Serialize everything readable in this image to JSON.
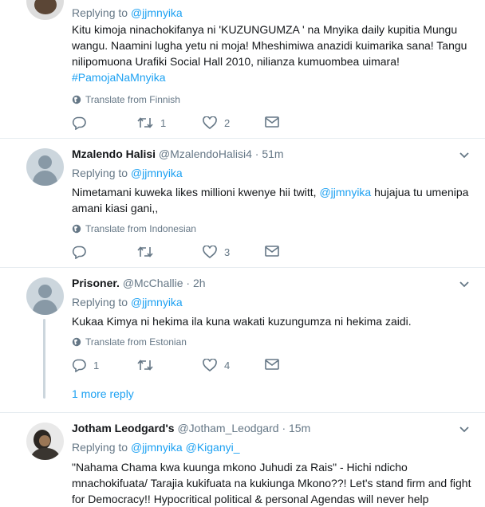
{
  "tweets": [
    {
      "replying_prefix": "Replying to",
      "replying_to": "@jjmnyika",
      "text": "Kitu kimoja ninachokifanya ni 'KUZUNGUMZA ' na Mnyika daily kupitia Mungu wangu. Naamini lugha yetu ni moja! Mheshimiwa anazidi kuimarika sana! Tangu nilipomuona Urafiki Social Hall 2010, nilianza kumuombea uimara!",
      "hashtag": "#PamojaNaMnyika",
      "translate": "Translate from Finnish",
      "reply_count": "",
      "retweet_count": "1",
      "like_count": "2"
    },
    {
      "name": "Mzalendo Halisi",
      "handle": "@MzalendoHalisi4",
      "dot": "·",
      "time": "51m",
      "replying_prefix": "Replying to",
      "replying_to": "@jjmnyika",
      "text_before": "Nimetamani kuweka likes millioni kwenye hii twitt, ",
      "mention": "@jjmnyika",
      "text_after": " hujajua tu umenipa amani kiasi gani,,",
      "translate": "Translate from Indonesian",
      "reply_count": "",
      "retweet_count": "",
      "like_count": "3"
    },
    {
      "name": "Prisoner.",
      "handle": "@McChallie",
      "dot": "·",
      "time": "2h",
      "replying_prefix": "Replying to",
      "replying_to": "@jjmnyika",
      "text": "Kukaa Kimya ni hekima ila kuna wakati kuzungumza ni hekima zaidi.",
      "translate": "Translate from Estonian",
      "reply_count": "1",
      "retweet_count": "",
      "like_count": "4",
      "more_reply": "1 more reply"
    },
    {
      "name": "Jotham Leodgard's",
      "handle": "@Jotham_Leodgard",
      "dot": "·",
      "time": "15m",
      "replying_prefix": "Replying to",
      "replying_to": "@jjmnyika",
      "replying_to_2": "@Kiganyi_",
      "text": "\"Nahama Chama kwa kuunga mkono Juhudi za Rais\" - Hichi ndicho mnachokifuata/  Tarajia kukifuata na kukiunga Mkono??! Let's stand firm and fight for Democracy!! Hypocritical political & personal Agendas will never help"
    }
  ],
  "colors": {
    "accent": "#1da1f2",
    "muted": "#657786",
    "text": "#14171a",
    "border": "#e6ecf0"
  },
  "icons": [
    "reply-icon",
    "retweet-icon",
    "like-icon",
    "dm-icon",
    "globe-icon",
    "chevron-down-icon"
  ]
}
